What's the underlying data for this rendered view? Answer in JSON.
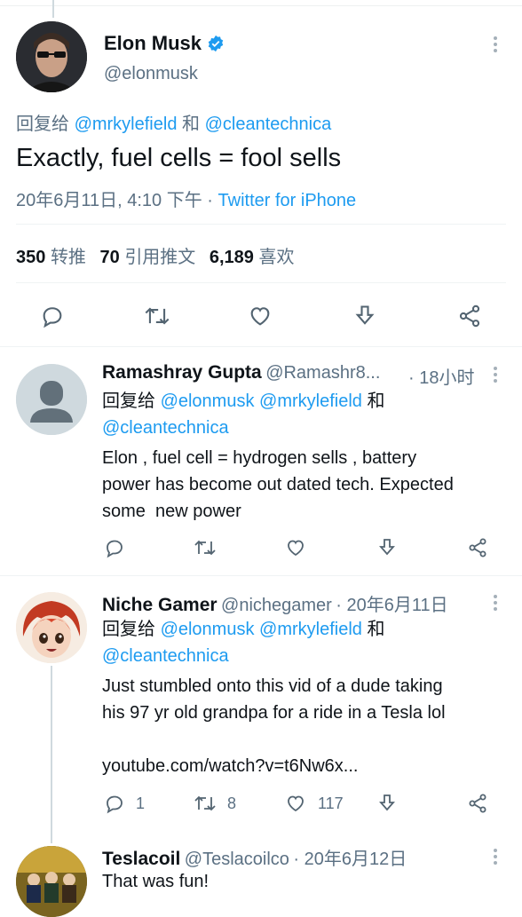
{
  "main_tweet": {
    "name": "Elon Musk",
    "handle": "@elonmusk",
    "reply_prefix": "回复给",
    "reply_user1": "@mrkylefield",
    "reply_conj": "和",
    "reply_user2": "@cleantechnica",
    "text": "Exactly, fuel cells = fool sells",
    "timestamp": "20年6月11日, 4:10 下午",
    "dot": "·",
    "source": "Twitter for iPhone",
    "retweets_count": "350",
    "retweets_label": "转推",
    "quotes_count": "70",
    "quotes_label": "引用推文",
    "likes_count": "6,189",
    "likes_label": "喜欢"
  },
  "replies": [
    {
      "name": "Ramashray Gupta",
      "handle": "@Ramashr8...",
      "time": "· 18小时",
      "reply_prefix": "回复给",
      "reply_user1": "@elonmusk",
      "reply_user2": "@mrkylefield",
      "reply_conj": "和",
      "reply_user3": "@cleantechnica",
      "text_line1": "Elon , fuel cell = hydrogen sells , battery",
      "text_line2": "power has become out dated tech. Expected",
      "text_line3": "some  new power"
    },
    {
      "name": "Niche Gamer",
      "handle": "@nichegamer",
      "time": "· 20年6月11日",
      "reply_prefix": "回复给",
      "reply_user1": "@elonmusk",
      "reply_user2": "@mrkylefield",
      "reply_conj": "和",
      "reply_user3": "@cleantechnica",
      "text_line1": "Just stumbled onto this vid of a dude taking",
      "text_line2": "his 97 yr old grandpa for a ride in a Tesla lol",
      "link": "youtube.com/watch?v=t6Nw6x...",
      "reply_count": "1",
      "retweet_count": "8",
      "like_count": "117"
    },
    {
      "name": "Teslacoil",
      "handle": "@Teslacoilco",
      "time": "· 20年6月12日",
      "text_line1": "That was fun!"
    }
  ],
  "icons": {
    "reply": "reply-icon",
    "retweet": "retweet-icon",
    "like": "heart-icon",
    "save": "download-icon",
    "share": "share-icon",
    "verified": "verified-badge-icon",
    "more": "more-icon"
  },
  "colors": {
    "link": "#1d9bf0",
    "secondary_text": "#5b7083",
    "verified": "#1d9bf0"
  }
}
